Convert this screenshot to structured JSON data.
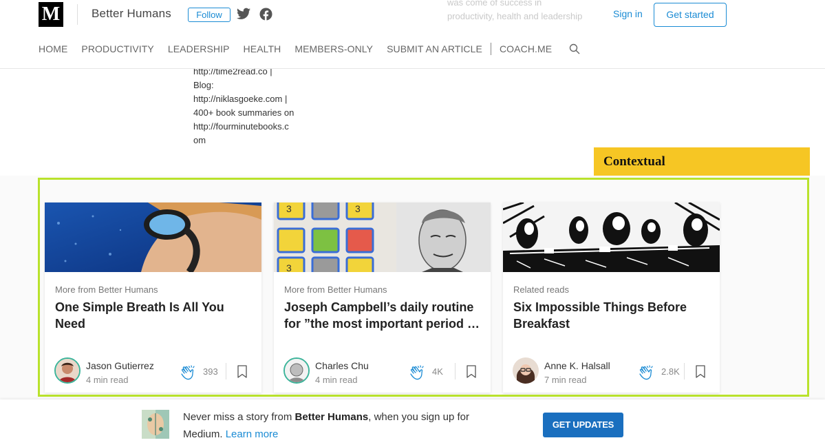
{
  "header": {
    "logo_letter": "M",
    "publication": "Better Humans",
    "follow_label": "Follow",
    "sign_in": "Sign in",
    "get_started": "Get started",
    "bg_snippet": "was come of success in productivity, health and leadership",
    "nav": [
      "HOME",
      "PRODUCTIVITY",
      "LEADERSHIP",
      "HEALTH",
      "MEMBERS-ONLY",
      "SUBMIT AN ARTICLE",
      "COACH.ME"
    ]
  },
  "bio_lines": [
    "http://time2read.co |",
    "Blog:",
    "http://niklasgoeke.com |",
    "400+ book summaries on",
    "http://fourminutebooks.c",
    "om"
  ],
  "contextual_label": "Contextual",
  "cards": [
    {
      "kicker": "More from Better Humans",
      "title": "One Simple Breath Is All You Need",
      "author": "Jason Gutierrez",
      "read_time": "4 min read",
      "claps": "393"
    },
    {
      "kicker": "More from Better Humans",
      "title": "Joseph Campbell’s daily routine for ”the most important period …",
      "author": "Charles Chu",
      "read_time": "4 min read",
      "claps": "4K"
    },
    {
      "kicker": "Related reads",
      "title": "Six Impossible Things Before Breakfast",
      "author": "Anne K. Halsall",
      "read_time": "7 min read",
      "claps": "2.8K"
    }
  ],
  "bottom_bar": {
    "text_pre": "Never miss a story from ",
    "publication": "Better Humans",
    "text_post": ", when you sign up for Medium. ",
    "learn_more": "Learn more",
    "cta": "GET UPDATES"
  },
  "colors": {
    "accent": "#1a8bd4",
    "highlight_frame": "#b9e22c",
    "label_bg": "#f6c624",
    "cta_bg": "#1a6fbf"
  },
  "icons": [
    "twitter-icon",
    "facebook-icon",
    "search-icon",
    "clap-icon",
    "bookmark-icon"
  ]
}
